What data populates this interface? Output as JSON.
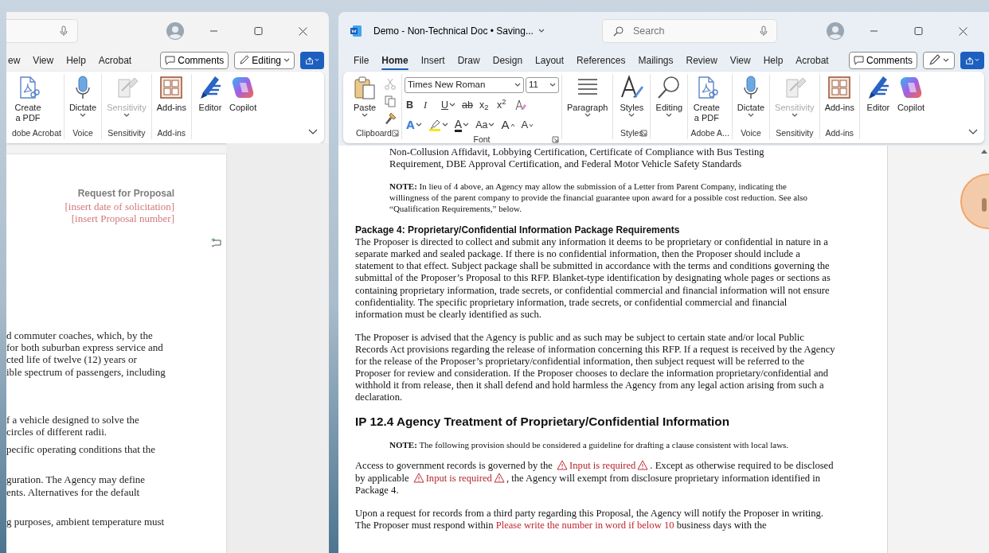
{
  "left_window": {
    "tabs": [
      {
        "label": "ew",
        "selected": false
      },
      {
        "label": "View",
        "selected": false
      },
      {
        "label": "Help",
        "selected": false
      },
      {
        "label": "Acrobat",
        "selected": false
      }
    ],
    "comments_button": "Comments",
    "editing_button": "Editing",
    "ribbon": [
      {
        "label": "dobe Acrobat",
        "items": [
          {
            "kind": "create_pdf",
            "label": "Create\na PDF",
            "disabled": false
          }
        ]
      },
      {
        "label": "Voice",
        "items": [
          {
            "kind": "dictate",
            "label": "Dictate",
            "dropdown": true,
            "disabled": false
          }
        ]
      },
      {
        "label": "Sensitivity",
        "items": [
          {
            "kind": "sensitivity",
            "label": "Sensitivity",
            "dropdown": true,
            "disabled": true
          }
        ]
      },
      {
        "label": "Add-ins",
        "items": [
          {
            "kind": "addins",
            "label": "Add-ins",
            "disabled": false
          }
        ]
      },
      {
        "items": [
          {
            "kind": "editor",
            "label": "Editor",
            "disabled": false
          },
          {
            "kind": "copilot",
            "label": "Copilot",
            "disabled": false
          }
        ]
      }
    ],
    "document": {
      "header": [
        {
          "kind": "title",
          "text": "Request for Proposal"
        },
        {
          "kind": "placeholder",
          "text": "[insert date of solicitation]"
        },
        {
          "kind": "placeholder",
          "text": "[insert Proposal number]"
        }
      ],
      "fragments": [
        [
          "d commuter coaches, which, by the",
          "for both suburban express service and",
          "cted life of twelve (12) years or",
          "ible spectrum of passengers, including"
        ],
        [
          "f a vehicle designed to solve the",
          "circles of different radii."
        ],
        [
          "pecific operating conditions that the"
        ],
        [
          "guration. The Agency may define",
          "ents. Alternatives for the default"
        ],
        [
          "g purposes, ambient temperature must"
        ]
      ]
    }
  },
  "right_window": {
    "title": "Demo - Non-Technical Doc • Saving...",
    "search_placeholder": "Search",
    "tabs": [
      {
        "label": "File",
        "selected": false
      },
      {
        "label": "Home",
        "selected": true
      },
      {
        "label": "Insert",
        "selected": false
      },
      {
        "label": "Draw",
        "selected": false
      },
      {
        "label": "Design",
        "selected": false
      },
      {
        "label": "Layout",
        "selected": false
      },
      {
        "label": "References",
        "selected": false
      },
      {
        "label": "Mailings",
        "selected": false
      },
      {
        "label": "Review",
        "selected": false
      },
      {
        "label": "View",
        "selected": false
      },
      {
        "label": "Help",
        "selected": false
      },
      {
        "label": "Acrobat",
        "selected": false
      }
    ],
    "comments_button": "Comments",
    "ribbon": [
      {
        "label": "Clipboard",
        "launcher": true,
        "items": [
          {
            "kind": "paste",
            "label": "Paste",
            "dropdown": true,
            "disabled": false
          },
          {
            "kind": "stack",
            "buttons": [
              {
                "kind": "cut",
                "disabled": true
              },
              {
                "kind": "copy",
                "disabled": false
              },
              {
                "kind": "painter",
                "disabled": false
              }
            ]
          }
        ]
      },
      {
        "label": "Font",
        "launcher": true,
        "items": [
          {
            "kind": "font",
            "font": "Times New Roman",
            "size": "11",
            "row1": [
              {
                "kind": "bold",
                "label": "B"
              },
              {
                "kind": "italic",
                "label": "I"
              },
              {
                "kind": "underline",
                "label": "U",
                "dropdown": true
              },
              {
                "kind": "strike",
                "label": "ab"
              },
              {
                "kind": "plain",
                "label": "x$_{2}$"
              },
              {
                "kind": "plain",
                "label": "x$^{2}$"
              },
              {
                "kind": "clear"
              }
            ],
            "row2": [
              {
                "kind": "effects",
                "label": "A",
                "dropdown": true
              },
              {
                "kind": "highlight",
                "dropdown": true
              },
              {
                "kind": "color",
                "label": "A",
                "dropdown": true
              },
              {
                "kind": "plain",
                "label": "Aa",
                "dropdown": true
              },
              {
                "kind": "grow",
                "label": "A"
              },
              {
                "kind": "shrink",
                "label": "A"
              }
            ]
          }
        ]
      },
      {
        "items": [
          {
            "kind": "paragraph",
            "label": "Paragraph",
            "dropdown": true,
            "disabled": false
          }
        ]
      },
      {
        "label": "Styles",
        "launcher": true,
        "items": [
          {
            "kind": "styles",
            "label": "Styles",
            "dropdown": true,
            "disabled": false
          }
        ]
      },
      {
        "items": [
          {
            "kind": "editing",
            "label": "Editing",
            "dropdown": true,
            "disabled": false
          }
        ]
      },
      {
        "label": "Adobe A...",
        "items": [
          {
            "kind": "create_pdf",
            "label": "Create\na PDF",
            "disabled": false
          }
        ]
      },
      {
        "label": "Voice",
        "items": [
          {
            "kind": "dictate",
            "label": "Dictate",
            "dropdown": true,
            "disabled": false
          }
        ]
      },
      {
        "label": "Sensitivity",
        "items": [
          {
            "kind": "sensitivity",
            "label": "Sensitivity",
            "dropdown": true,
            "disabled": true
          }
        ]
      },
      {
        "label": "Add-ins",
        "items": [
          {
            "kind": "addins",
            "label": "Add-ins",
            "disabled": false
          }
        ]
      },
      {
        "items": [
          {
            "kind": "editor",
            "label": "Editor",
            "disabled": false
          },
          {
            "kind": "copilot",
            "label": "Copilot",
            "disabled": false
          }
        ]
      }
    ],
    "document": {
      "blocks": [
        {
          "kind": "indented",
          "text": "Non-Collusion Affidavit, Lobbying Certification, Certificate of Compliance with Bus Testing Requirement, DBE Approval Certification, and Federal Motor Vehicle Safety Standards"
        },
        {
          "kind": "note",
          "text": "**NOTE:** In lieu of 4 above, an Agency may allow the submission of a Letter from Parent Company, indicating the willingness of the parent company to provide the financial guarantee upon award for a possible cost reduction. See also “Qualification Requirements,” below."
        },
        {
          "kind": "subheading",
          "text": "Package 4: Proprietary/Confidential Information Package Requirements"
        },
        {
          "kind": "body",
          "text": "The Proposer is directed to collect and submit any information it deems to be proprietary or confidential in nature in a separate marked and sealed package. If there is no confidential information, then the Proposer should include a statement to that effect. Subject package shall be submitted in accordance with the terms and conditions governing the submittal of the Proposer’s Proposal to this RFP. Blanket-type identification by designating whole pages or sections as containing proprietary information, trade secrets, or confidential commercial and financial information will not ensure confidentiality. The specific proprietary information, trade secrets, or confidential commercial and financial information must be clearly identified as such."
        },
        {
          "kind": "body",
          "text": "The Proposer is advised that the Agency is public and as such may be subject to certain state and/or local Public Records Act provisions regarding the release of information concerning this RFP. If a request is received by the Agency for the release of the Proposer’s proprietary/confidential information, then subject request will be referred to the Proposer for review and consideration. If the Proposer chooses to declare the information proprietary/confidential and withhold it from release, then it shall defend and hold harmless the Agency from any legal action arising from such a declaration."
        },
        {
          "kind": "heading",
          "text": "IP 12.4 Agency Treatment of Proprietary/Confidential Information"
        },
        {
          "kind": "note",
          "text": "**NOTE:** The following provision should be considered a guideline for drafting a clause consistent with local laws."
        },
        {
          "kind": "mixed",
          "segments": [
            {
              "kind": "plain",
              "text": "Access to government records is governed by the "
            },
            {
              "kind": "required",
              "text": "Input is required"
            },
            {
              "kind": "plain",
              "text": ". Except as otherwise required to be disclosed by applicable "
            },
            {
              "kind": "required",
              "text": "Input is required"
            },
            {
              "kind": "plain",
              "text": ", the Agency will exempt from disclosure proprietary information identified in Package 4."
            }
          ]
        },
        {
          "kind": "mixed",
          "segments": [
            {
              "kind": "plain",
              "text": "Upon a request for records from a third party regarding this Proposal, the Agency will notify the Proposer in writing. The Proposer must respond within "
            },
            {
              "kind": "hint",
              "text": "Please write the number in word if below 10"
            },
            {
              "kind": "plain",
              "text": " business days with the"
            }
          ]
        }
      ]
    }
  }
}
